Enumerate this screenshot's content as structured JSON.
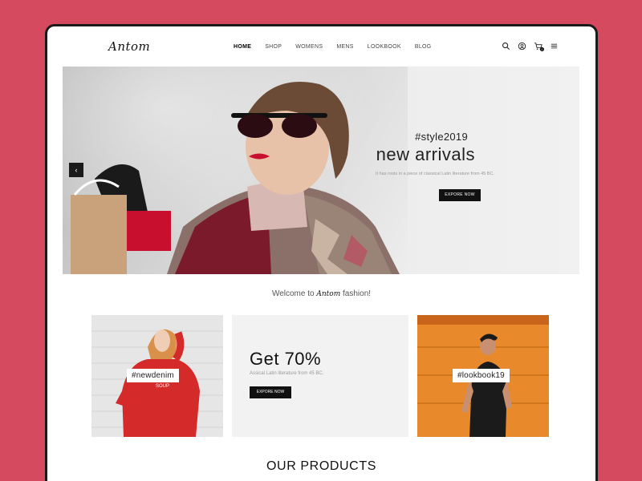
{
  "header": {
    "logo": "Antom",
    "nav": [
      {
        "label": "HOME",
        "active": true
      },
      {
        "label": "SHOP"
      },
      {
        "label": "WOMENS"
      },
      {
        "label": "MENS"
      },
      {
        "label": "LOOKBOOK"
      },
      {
        "label": "BLOG"
      }
    ],
    "icons": [
      "search-icon",
      "user-icon",
      "cart-icon",
      "menu-icon"
    ],
    "cart_count": "0"
  },
  "hero": {
    "tag": "#style2019",
    "title": "new arrivals",
    "subtitle": "It has roots in a piece of classical Latin literature from 45 BC.",
    "button": "EXPORE NOW",
    "prev_arrow": "‹",
    "next_arrow": "›"
  },
  "welcome": {
    "prefix": "Welcome to",
    "brand": "Antom",
    "suffix": "fashion!"
  },
  "promos": {
    "left_label": "#newdenim",
    "sweater_text": "SOUP",
    "mid_title": "Get 70%",
    "mid_subtitle": "Assical Latin literature from 45 BC.",
    "mid_button": "EXPORE NOW",
    "right_label": "#lookbook19"
  },
  "products": {
    "title": "OUR PRODUCTS"
  },
  "colors": {
    "background": "#d64a5f",
    "accent_dark": "#111111",
    "lips": "#c8102e",
    "jacket": "#7a1a2a",
    "sweater": "#d42a2a",
    "orange_door": "#e88a2c"
  }
}
